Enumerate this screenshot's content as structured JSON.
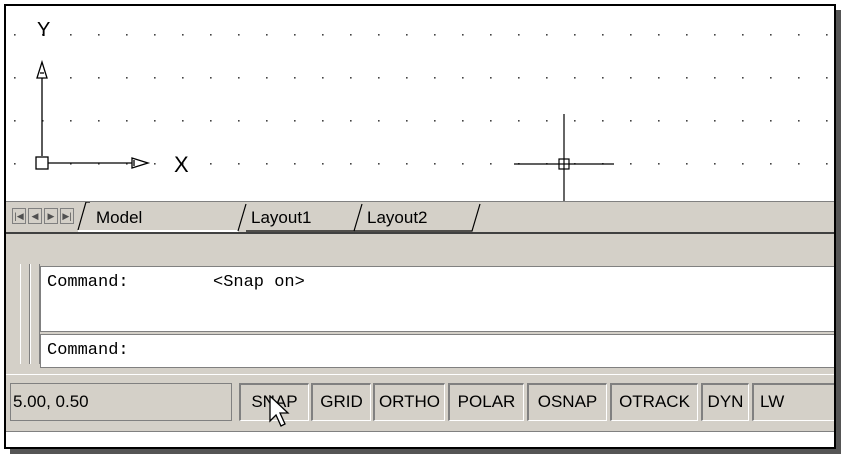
{
  "axis": {
    "y_label": "Y",
    "x_label": "X"
  },
  "layout_tabs": {
    "nav_icons": [
      "first-icon",
      "prev-icon",
      "next-icon",
      "last-icon"
    ],
    "tabs": [
      "Model",
      "Layout1",
      "Layout2"
    ],
    "active": "Model"
  },
  "command": {
    "history_prefix": "Command:",
    "history_message": "<Snap on>",
    "prompt": "Command:"
  },
  "status_bar": {
    "coordinates": "5.00, 0.50",
    "toggles": [
      "SNAP",
      "GRID",
      "ORTHO",
      "POLAR",
      "OSNAP",
      "OTRACK",
      "DYN",
      "LW"
    ]
  },
  "colors": {
    "face": "#d4d0c8",
    "shadow": "#808080",
    "canvas": "#ffffff"
  }
}
